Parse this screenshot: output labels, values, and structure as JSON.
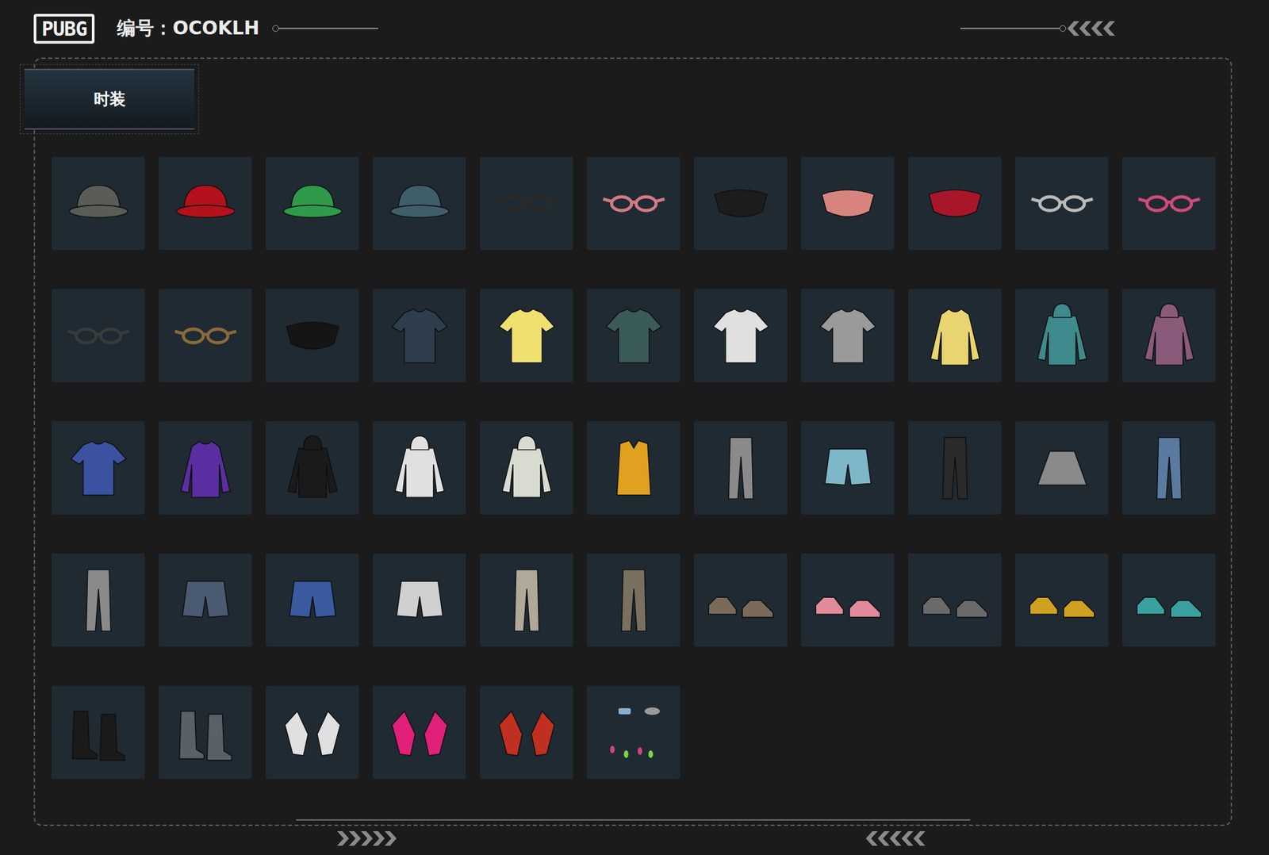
{
  "header": {
    "logo": "PUBG",
    "id_label": "编号：OCOKLH"
  },
  "tabs": [
    {
      "label": "时装",
      "selected": true
    }
  ],
  "items": [
    {
      "kind": "hat",
      "color": "#5a5d55"
    },
    {
      "kind": "hat",
      "color": "#b3121c"
    },
    {
      "kind": "hat",
      "color": "#2f9a4a"
    },
    {
      "kind": "hat",
      "color": "#3e5f6a"
    },
    {
      "kind": "glasses",
      "color": "#2a2a2a"
    },
    {
      "kind": "glasses",
      "color": "#d27a86"
    },
    {
      "kind": "mask",
      "color": "#1c1c1c"
    },
    {
      "kind": "mask",
      "color": "#d7847f"
    },
    {
      "kind": "mask",
      "color": "#a8162a"
    },
    {
      "kind": "glasses",
      "color": "#bbbbbb"
    },
    {
      "kind": "glasses",
      "color": "#d04a7a"
    },
    {
      "kind": "glasses",
      "color": "#3a3a3a"
    },
    {
      "kind": "glasses",
      "color": "#8a6a3a"
    },
    {
      "kind": "mask",
      "color": "#151515"
    },
    {
      "kind": "shirt",
      "color": "#2e3d4e"
    },
    {
      "kind": "shirt",
      "color": "#f0e070"
    },
    {
      "kind": "shirt",
      "color": "#3b5a5a"
    },
    {
      "kind": "shirt",
      "color": "#e0e0e0"
    },
    {
      "kind": "shirt",
      "color": "#9a9a9a"
    },
    {
      "kind": "jacket",
      "color": "#e8d570"
    },
    {
      "kind": "hoodie",
      "color": "#3f8a8c"
    },
    {
      "kind": "hoodie",
      "color": "#8a5a7a"
    },
    {
      "kind": "shirt",
      "color": "#3a52a0"
    },
    {
      "kind": "jacket",
      "color": "#5a2ea0"
    },
    {
      "kind": "hoodie",
      "color": "#1a1a1a"
    },
    {
      "kind": "hoodie",
      "color": "#e0e0e0"
    },
    {
      "kind": "hoodie",
      "color": "#d8dcd0"
    },
    {
      "kind": "vest",
      "color": "#e0a020"
    },
    {
      "kind": "pants",
      "color": "#8a8a8a"
    },
    {
      "kind": "shorts",
      "color": "#7eb8c8"
    },
    {
      "kind": "pants",
      "color": "#2a2a2a"
    },
    {
      "kind": "skirt",
      "color": "#8a8a8a"
    },
    {
      "kind": "pants",
      "color": "#5a7aa0"
    },
    {
      "kind": "pants",
      "color": "#8a8a8a"
    },
    {
      "kind": "shorts",
      "color": "#4a5a70"
    },
    {
      "kind": "shorts",
      "color": "#3a5aa0"
    },
    {
      "kind": "shorts",
      "color": "#d0d0d0"
    },
    {
      "kind": "pants",
      "color": "#b0a898"
    },
    {
      "kind": "pants",
      "color": "#7a7060"
    },
    {
      "kind": "shoes",
      "color": "#7a6a5a"
    },
    {
      "kind": "shoes",
      "color": "#e08a9a"
    },
    {
      "kind": "shoes",
      "color": "#6a6a6a"
    },
    {
      "kind": "shoes",
      "color": "#d0a020"
    },
    {
      "kind": "shoes",
      "color": "#3aa0a0"
    },
    {
      "kind": "boots",
      "color": "#1a1a1a"
    },
    {
      "kind": "boots",
      "color": "#5a6068"
    },
    {
      "kind": "gloves",
      "color": "#e0e0e0"
    },
    {
      "kind": "gloves",
      "color": "#e0207a"
    },
    {
      "kind": "gloves",
      "color": "#c03020"
    },
    {
      "kind": "nails",
      "color": "#d04080"
    }
  ]
}
